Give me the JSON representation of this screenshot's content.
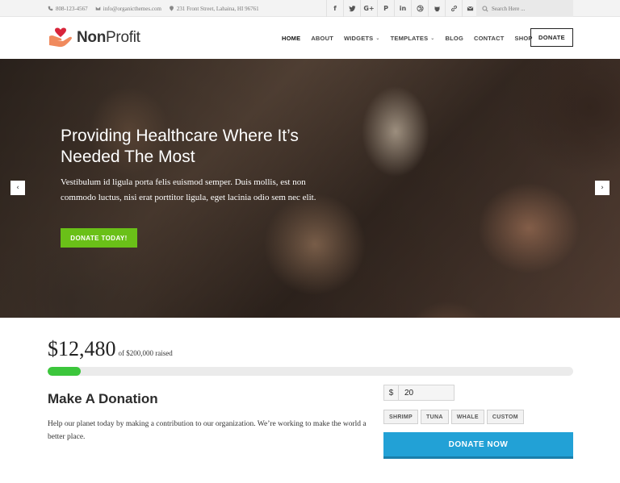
{
  "topbar": {
    "phone": "808-123-4567",
    "email": "info@organicthemes.com",
    "address": "231 Front Street, Lahaina, HI 96761",
    "social": [
      {
        "name": "facebook",
        "glyph": "f"
      },
      {
        "name": "twitter",
        "glyph": ""
      },
      {
        "name": "google-plus",
        "glyph": "G+"
      },
      {
        "name": "pinterest",
        "glyph": "P"
      },
      {
        "name": "linkedin",
        "glyph": "in"
      },
      {
        "name": "dribbble",
        "glyph": ""
      },
      {
        "name": "github",
        "glyph": ""
      },
      {
        "name": "link",
        "glyph": ""
      },
      {
        "name": "mail",
        "glyph": ""
      }
    ],
    "search_placeholder": "Search Here ..."
  },
  "header": {
    "brand_bold": "Non",
    "brand_light": "Profit",
    "nav": [
      {
        "label": "HOME",
        "active": true,
        "dropdown": false
      },
      {
        "label": "ABOUT",
        "active": false,
        "dropdown": false
      },
      {
        "label": "WIDGETS",
        "active": false,
        "dropdown": true
      },
      {
        "label": "TEMPLATES",
        "active": false,
        "dropdown": true
      },
      {
        "label": "BLOG",
        "active": false,
        "dropdown": false
      },
      {
        "label": "CONTACT",
        "active": false,
        "dropdown": false
      },
      {
        "label": "SHOP",
        "active": false,
        "dropdown": false
      }
    ],
    "donate_label": "DONATE"
  },
  "hero": {
    "title": "Providing Healthcare Where It’s Needed The Most",
    "text": "Vestibulum id ligula porta felis euismod semper. Duis mollis, est non commodo luctus, nisi erat porttitor ligula, eget lacinia odio sem nec elit.",
    "cta_label": "DONATE TODAY!",
    "prev_arrow": "‹",
    "next_arrow": "›"
  },
  "donation": {
    "raised_amount": "$12,480",
    "goal_text": "of $200,000 raised",
    "progress_fraction": 0.0624,
    "title": "Make A Donation",
    "description": "Help our planet today by making a contribution to our organization. We’re working to make the world a better place.",
    "currency_symbol": "$",
    "amount_value": "20",
    "presets": [
      "SHRIMP",
      "TUNA",
      "WHALE",
      "CUSTOM"
    ],
    "submit_label": "DONATE NOW"
  },
  "colors": {
    "accent_green": "#6ac018",
    "progress_green": "#3cc63c",
    "donate_blue": "#22a1d6",
    "logo_red": "#d8243a",
    "logo_orange": "#f08a5d"
  }
}
